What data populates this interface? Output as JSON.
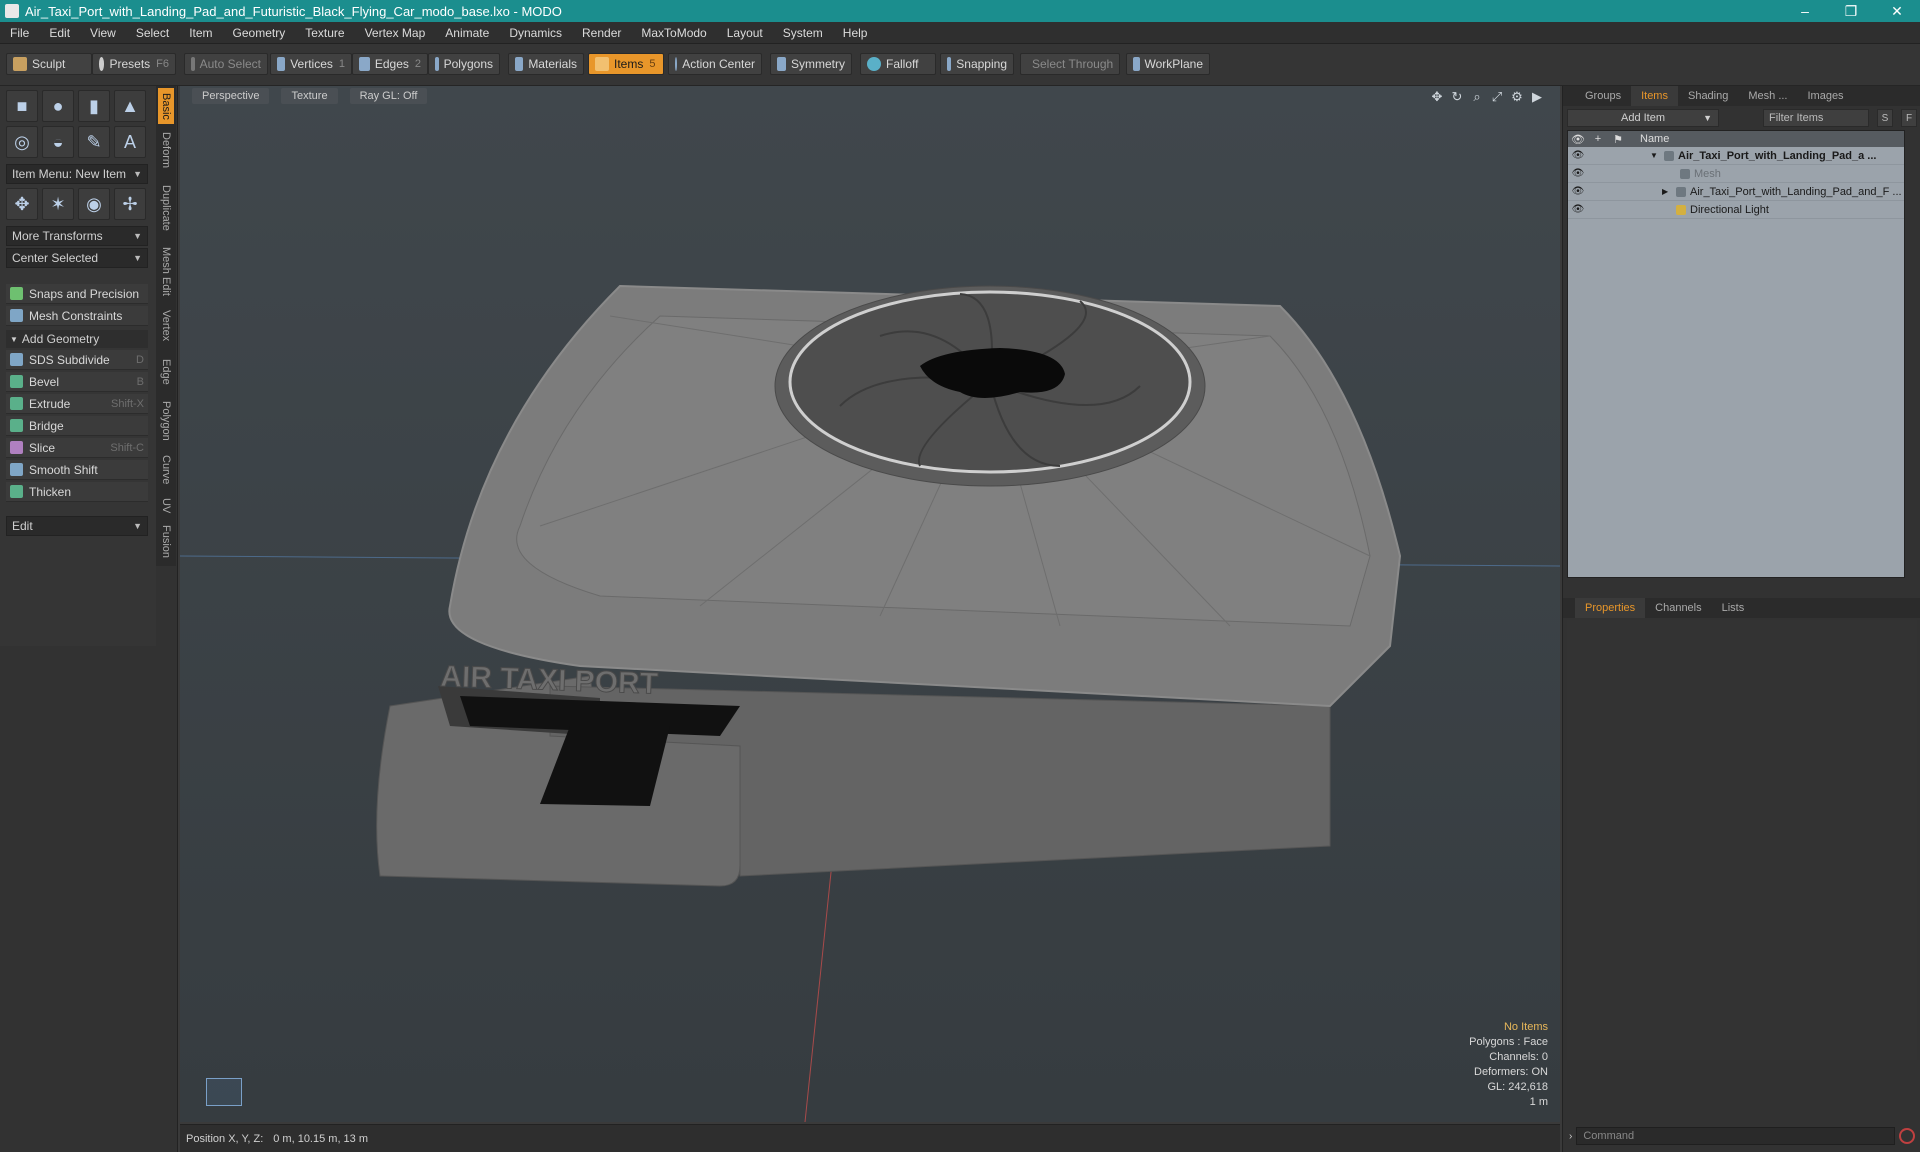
{
  "window": {
    "title": "Air_Taxi_Port_with_Landing_Pad_and_Futuristic_Black_Flying_Car_modo_base.lxo - MODO",
    "minimize": "–",
    "restore": "❐",
    "close": "✕"
  },
  "menu": [
    "File",
    "Edit",
    "View",
    "Select",
    "Item",
    "Geometry",
    "Texture",
    "Vertex Map",
    "Animate",
    "Dynamics",
    "Render",
    "MaxToModo",
    "Layout",
    "System",
    "Help"
  ],
  "toolbar": {
    "sculpt": "Sculpt",
    "presets": "Presets",
    "presets_key": "F6",
    "auto_select": "Auto Select",
    "vertices": "Vertices",
    "vertices_key": "1",
    "edges": "Edges",
    "edges_key": "2",
    "polygons": "Polygons",
    "materials": "Materials",
    "items": "Items",
    "items_key": "5",
    "action_center": "Action Center",
    "symmetry": "Symmetry",
    "falloff": "Falloff",
    "snapping": "Snapping",
    "select_through": "Select Through",
    "workplane": "WorkPlane"
  },
  "left": {
    "item_menu": "Item Menu: New Item",
    "more_transforms": "More Transforms",
    "center_selected": "Center Selected",
    "snaps": "Snaps and Precision",
    "constraints": "Mesh Constraints",
    "add_geometry": "Add Geometry",
    "tools": [
      {
        "label": "SDS Subdivide",
        "key": "D"
      },
      {
        "label": "Bevel",
        "key": "B"
      },
      {
        "label": "Extrude",
        "key": "Shift-X"
      },
      {
        "label": "Bridge",
        "key": ""
      },
      {
        "label": "Slice",
        "key": "Shift-C"
      },
      {
        "label": "Smooth Shift",
        "key": ""
      },
      {
        "label": "Thicken",
        "key": ""
      }
    ],
    "edit": "Edit",
    "vtabs": [
      "Basic",
      "Deform",
      "Duplicate",
      "Mesh Edit",
      "Vertex",
      "Edge",
      "Polygon",
      "Curve",
      "UV",
      "Fusion"
    ]
  },
  "viewport": {
    "view": "Perspective",
    "shading": "Texture",
    "raygl": "Ray GL: Off",
    "sign_text": "AIR TAXI PORT",
    "info": {
      "no_items": "No Items",
      "polygons": "Polygons : Face",
      "channels": "Channels: 0",
      "deformers": "Deformers: ON",
      "gl": "GL: 242,618",
      "scale": "1 m"
    }
  },
  "status": {
    "label": "Position X, Y, Z:",
    "value": "0 m, 10.15 m, 13 m"
  },
  "right": {
    "tabs": [
      "Groups",
      "Items",
      "Shading",
      "Mesh ...",
      "Images"
    ],
    "add_item": "Add Item",
    "filter": "Filter Items",
    "s": "S",
    "f": "F",
    "col_name": "Name",
    "rows": [
      {
        "label": "Air_Taxi_Port_with_Landing_Pad_a ..."
      },
      {
        "label": "Mesh"
      },
      {
        "label": "Air_Taxi_Port_with_Landing_Pad_and_F ..."
      },
      {
        "label": "Directional Light"
      }
    ],
    "props_tabs": [
      "Properties",
      "Channels",
      "Lists"
    ],
    "command": "Command"
  },
  "colors": {
    "accent": "#e8962a",
    "titlebar": "#1b8e8e"
  }
}
